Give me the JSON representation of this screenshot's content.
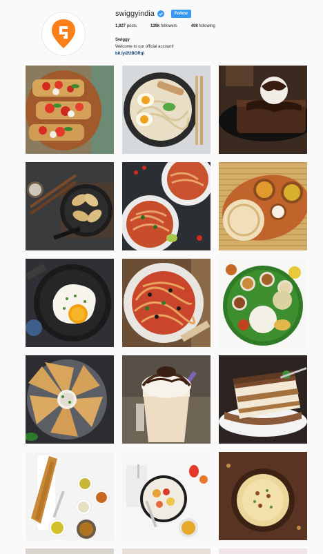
{
  "profile": {
    "username": "swiggyindia",
    "follow_label": "Follow",
    "posts_count": "1,927",
    "posts_label": "posts",
    "followers_count": "139k",
    "followers_label": "followers",
    "following_count": "408",
    "following_label": "following",
    "display_name": "Swiggy",
    "bio": "Welcome to our official account!",
    "link": "bit.ly/2UBORqi"
  },
  "posts": [
    {
      "subject": "bruschetta"
    },
    {
      "subject": "noodle-bowl"
    },
    {
      "subject": "brownie-ice-cream"
    },
    {
      "subject": "momos-pan"
    },
    {
      "subject": "spaghetti-plates"
    },
    {
      "subject": "paratha-curries"
    },
    {
      "subject": "fried-egg-pan"
    },
    {
      "subject": "spaghetti-bowl"
    },
    {
      "subject": "thali"
    },
    {
      "subject": "samosa-platter"
    },
    {
      "subject": "milkshake"
    },
    {
      "subject": "tiramisu"
    },
    {
      "subject": "dosa"
    },
    {
      "subject": "smoothie-bowl"
    },
    {
      "subject": "kheer"
    }
  ],
  "colors": {
    "brand": "#fc8019",
    "follow": "#3897f0"
  }
}
